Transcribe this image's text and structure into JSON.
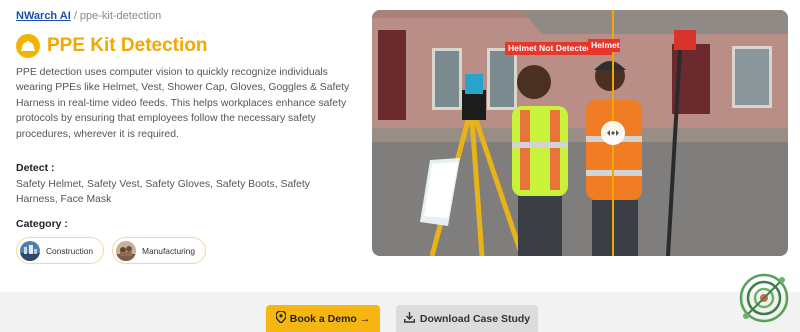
{
  "breadcrumb": {
    "home_label": "NWarch AI",
    "separator": "/",
    "current": "ppe-kit-detection"
  },
  "header": {
    "title": "PPE Kit Detection",
    "icon": "safety-helmet-icon"
  },
  "description": "PPE detection uses computer vision to quickly recognize individuals wearing PPEs like Helmet, Vest, Shower Cap, Gloves, Goggles & Safety Harness in real-time video feeds. This helps workplaces enhance safety protocols by ensuring that employees follow the necessary safety procedures, wherever it is required.",
  "detect": {
    "heading": "Detect :",
    "items_text": "Safety Helmet, Safety Vest, Safety Gloves, Safety Boots, Safety Harness, Face Mask"
  },
  "category": {
    "heading": "Category :",
    "chips": [
      {
        "label": "Construction"
      },
      {
        "label": "Manufacturing"
      }
    ]
  },
  "hero": {
    "labels": [
      "Helmet Not Detected",
      "Helmet"
    ],
    "label_color": "#e7372b",
    "divider_color": "#f3a800"
  },
  "actions": {
    "book_demo": "Book a Demo →",
    "download": "Download Case Study"
  },
  "colors": {
    "accent": "#f3a800",
    "link": "#1d4fa8",
    "button_primary": "#f6b612",
    "button_secondary": "#dcdcdc"
  }
}
